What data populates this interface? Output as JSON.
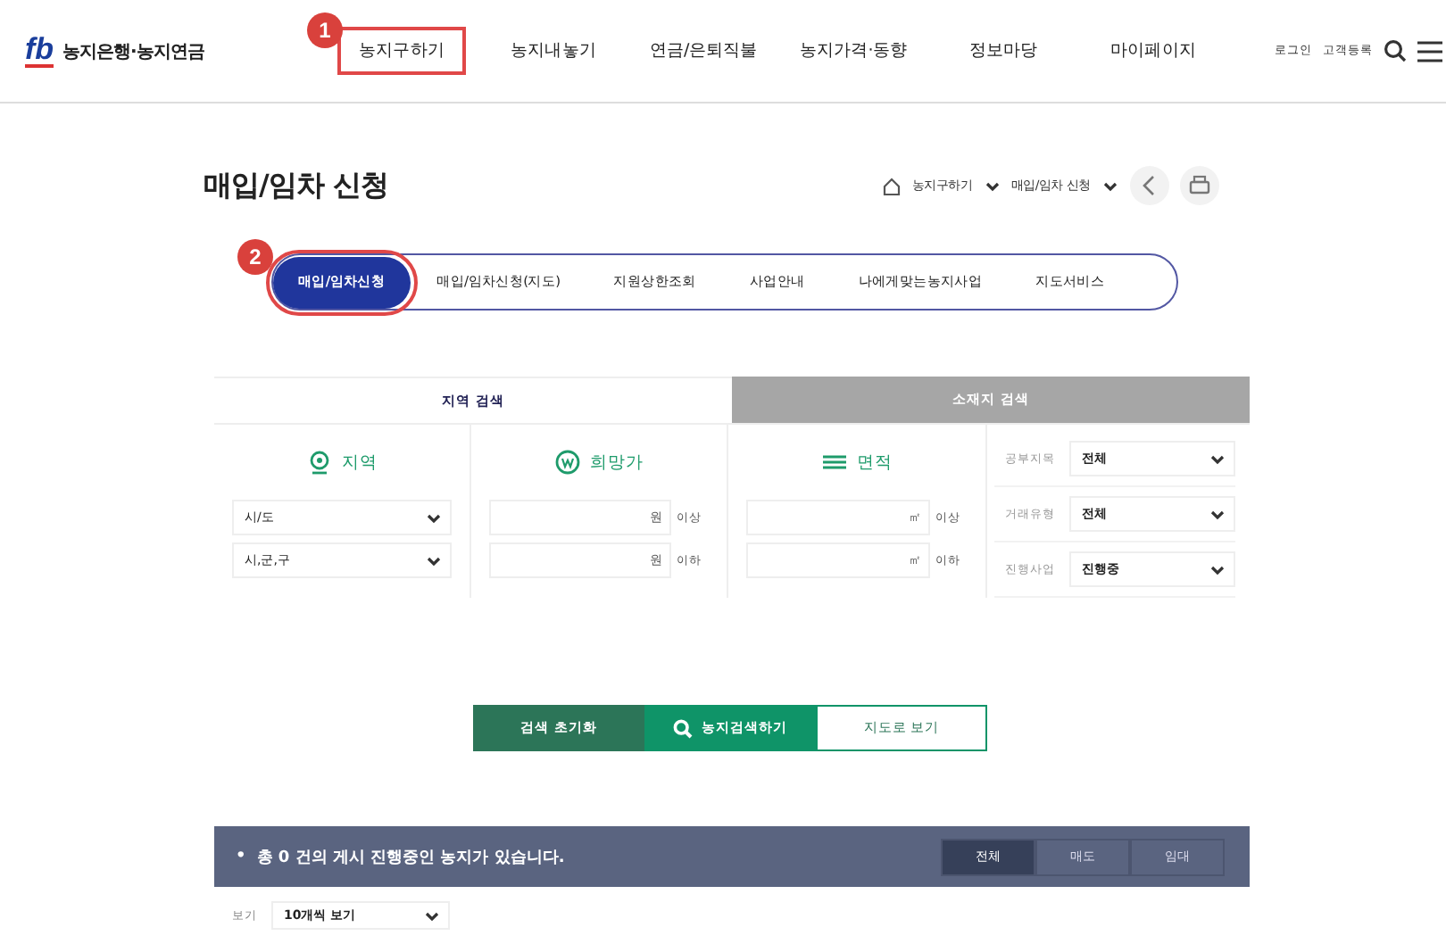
{
  "header": {
    "logo": "fb",
    "brand": "농지은행·농지연금",
    "nav": [
      {
        "label": "농지구하기",
        "highlighted": true,
        "callout": "1"
      },
      {
        "label": "농지내놓기",
        "highlighted": false
      },
      {
        "label": "연금/은퇴직불",
        "highlighted": false
      },
      {
        "label": "농지가격·동향",
        "highlighted": false
      },
      {
        "label": "정보마당",
        "highlighted": false
      },
      {
        "label": "마이페이지",
        "highlighted": false
      }
    ],
    "utility": [
      "로그인",
      "고객등록"
    ]
  },
  "page_title": "매입/임차 신청",
  "breadcrumb": [
    "농지구하기",
    "매입/임차 신청"
  ],
  "tabs": [
    {
      "label": "매입/임차신청",
      "selected": true,
      "callout": "2"
    },
    {
      "label": "매입/임차신청(지도)",
      "selected": false
    },
    {
      "label": "지원상한조회",
      "selected": false
    },
    {
      "label": "사업안내",
      "selected": false
    },
    {
      "label": "나에게맞는농지사업",
      "selected": false
    },
    {
      "label": "지도서비스",
      "selected": false
    }
  ],
  "search_tabs": [
    {
      "label": "지역 검색",
      "selected": true
    },
    {
      "label": "소재지 검색",
      "selected": false
    }
  ],
  "filters": {
    "region": {
      "title": "지역",
      "selects": [
        "시/도",
        "시,군,구"
      ]
    },
    "price": {
      "title": "희망가",
      "inputs": [
        {
          "unit": "원",
          "suffix": "이상"
        },
        {
          "unit": "원",
          "suffix": "이하"
        }
      ]
    },
    "area": {
      "title": "면적",
      "inputs": [
        {
          "unit": "㎡",
          "suffix": "이상"
        },
        {
          "unit": "㎡",
          "suffix": "이하"
        }
      ]
    },
    "options": [
      {
        "label": "공부지목",
        "value": "전체"
      },
      {
        "label": "거래유형",
        "value": "전체"
      },
      {
        "label": "진행사업",
        "value": "진행중"
      }
    ]
  },
  "actions": [
    {
      "label": "검색 초기화",
      "kind": "reset"
    },
    {
      "label": "농지검색하기",
      "kind": "search"
    },
    {
      "label": "지도로 보기",
      "kind": "map"
    }
  ],
  "result_bar": {
    "bullet": "•",
    "message": "총 **0** 건의 게시 진행중인 농지가 있습니다.",
    "filters": [
      {
        "label": "전체",
        "selected": true
      },
      {
        "label": "매도",
        "selected": false
      },
      {
        "label": "임대",
        "selected": false
      }
    ]
  },
  "page_size": {
    "label": "보기",
    "value": "10개씩 보기"
  }
}
